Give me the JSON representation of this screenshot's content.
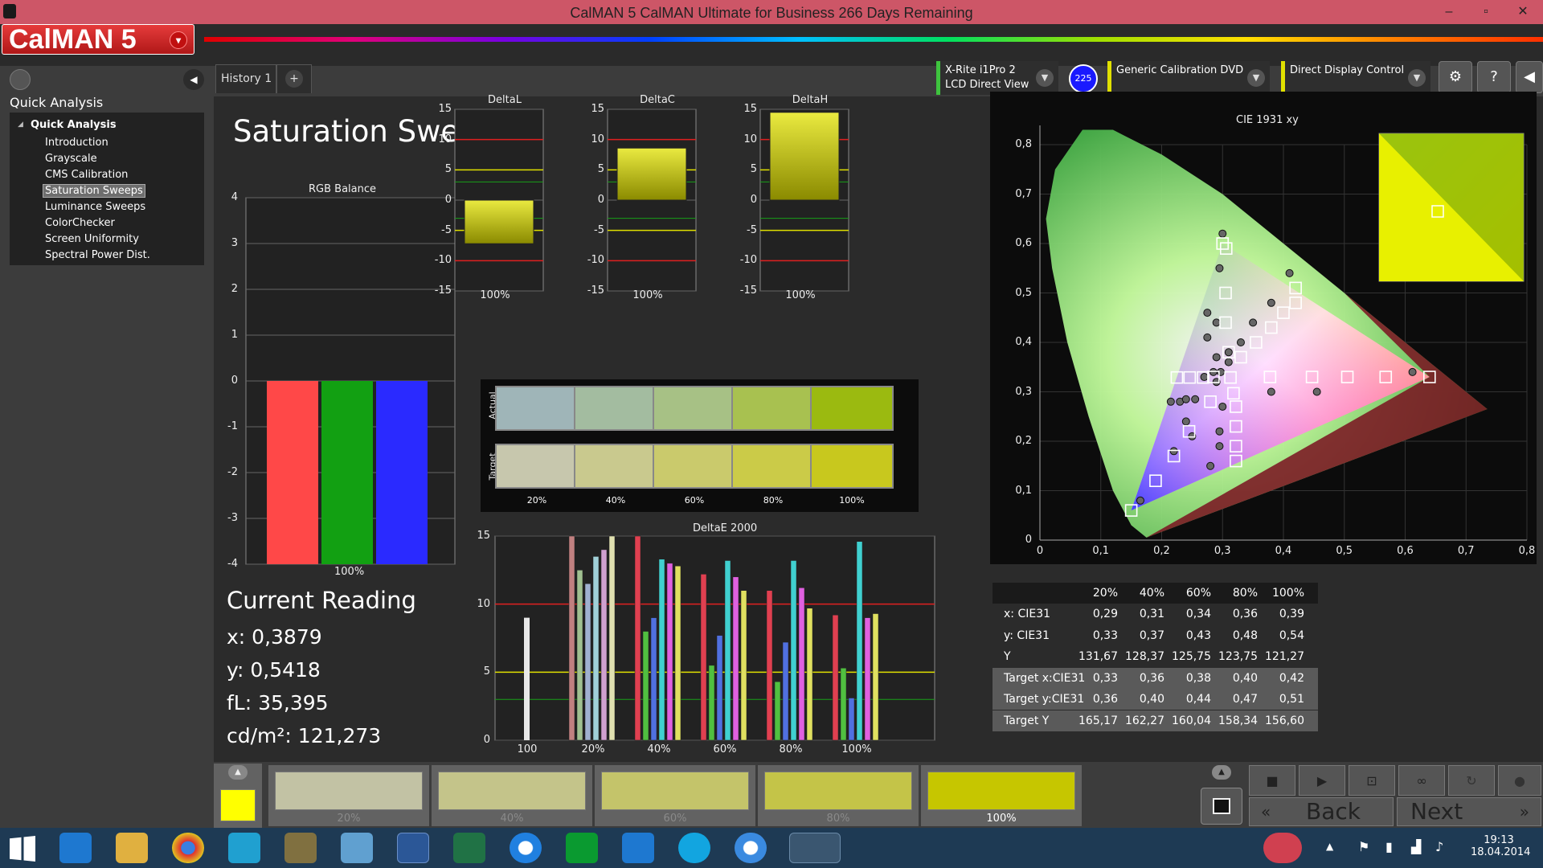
{
  "window": {
    "title": "CalMAN 5 CalMAN Ultimate for Business 266 Days Remaining",
    "minimize": "–",
    "restore": "▫",
    "close": "✕"
  },
  "logo": {
    "text": "CalMAN 5",
    "dropdown": "▾"
  },
  "sidebar": {
    "title": "Quick Analysis",
    "group": "Quick Analysis",
    "items": [
      "Introduction",
      "Grayscale",
      "CMS Calibration",
      "Saturation Sweeps",
      "Luminance Sweeps",
      "ColorChecker",
      "Screen Uniformity",
      "Spectral Power Dist."
    ],
    "selected": "Saturation Sweeps"
  },
  "tabs": {
    "history": "History 1",
    "add": "+"
  },
  "devices": {
    "meter_line1": "X-Rite i1Pro 2",
    "meter_line2": "LCD Direct View",
    "badge": "225",
    "source": "Generic Calibration DVD",
    "display": "Direct Display Control"
  },
  "page": {
    "title": "Saturation Sweeps"
  },
  "rgb_balance": {
    "title": "RGB Balance",
    "label": "100%",
    "yticks": [
      "4",
      "3",
      "2",
      "1",
      "0",
      "-1",
      "-2",
      "-3",
      "-4"
    ]
  },
  "delta_charts": [
    {
      "title": "DeltaL",
      "label": "100%",
      "yticks": [
        "15",
        "10",
        "5",
        "0",
        "-5",
        "-10",
        "-15"
      ]
    },
    {
      "title": "DeltaC",
      "label": "100%",
      "yticks": [
        "15",
        "10",
        "5",
        "0",
        "-5",
        "-10",
        "-15"
      ]
    },
    {
      "title": "DeltaH",
      "label": "100%",
      "yticks": [
        "15",
        "10",
        "5",
        "0",
        "-5",
        "-10",
        "-15"
      ]
    }
  ],
  "swatch_panel": {
    "actual_label": "Actual",
    "target_label": "Target",
    "labels": [
      "20%",
      "40%",
      "60%",
      "80%",
      "100%"
    ],
    "actual_colors": [
      "#9fb5b8",
      "#a3bca0",
      "#a7c185",
      "#a8c150",
      "#9bba10"
    ],
    "target_colors": [
      "#c7c7ad",
      "#c9c98e",
      "#caca6c",
      "#cbcb48",
      "#c8c81e"
    ]
  },
  "deltae": {
    "title": "DeltaE 2000",
    "xticks": [
      "100",
      "20%",
      "40%",
      "60%",
      "80%",
      "100%"
    ],
    "yticks": [
      "15",
      "10",
      "5",
      "0"
    ]
  },
  "current_reading": {
    "title": "Current Reading",
    "x": "x: 0,3879",
    "y": "y: 0,5418",
    "fl": "fL: 35,395",
    "cdm": "cd/m²: 121,273"
  },
  "cie": {
    "title": "CIE 1931 xy",
    "xticks": [
      "0",
      "0,1",
      "0,2",
      "0,3",
      "0,4",
      "0,5",
      "0,6",
      "0,7",
      "0,8"
    ],
    "yticks": [
      "0,8",
      "0,7",
      "0,6",
      "0,5",
      "0,4",
      "0,3",
      "0,2",
      "0,1",
      "0"
    ]
  },
  "table": {
    "headers": [
      "20%",
      "40%",
      "60%",
      "80%",
      "100%"
    ],
    "rows": [
      {
        "label": "x: CIE31",
        "values": [
          "0,29",
          "0,31",
          "0,34",
          "0,36",
          "0,39"
        ]
      },
      {
        "label": "y: CIE31",
        "values": [
          "0,33",
          "0,37",
          "0,43",
          "0,48",
          "0,54"
        ]
      },
      {
        "label": "Y",
        "values": [
          "131,67",
          "128,37",
          "125,75",
          "123,75",
          "121,27"
        ]
      },
      {
        "label": "Target x:CIE31",
        "values": [
          "0,33",
          "0,36",
          "0,38",
          "0,40",
          "0,42"
        ]
      },
      {
        "label": "Target y:CIE31",
        "values": [
          "0,36",
          "0,40",
          "0,44",
          "0,47",
          "0,51"
        ]
      },
      {
        "label": "Target Y",
        "values": [
          "165,17",
          "162,27",
          "160,04",
          "158,34",
          "156,60"
        ]
      }
    ]
  },
  "bottom": {
    "swatches": [
      {
        "label": "20%",
        "color": "#c2c2a4"
      },
      {
        "label": "40%",
        "color": "#c4c48a"
      },
      {
        "label": "60%",
        "color": "#c4c46a"
      },
      {
        "label": "80%",
        "color": "#c4c448"
      },
      {
        "label": "100%",
        "color": "#c6c600"
      }
    ],
    "current_color": "#ffff00",
    "back": "Back",
    "next": "Next"
  },
  "chart_data": [
    {
      "type": "bar",
      "title": "RGB Balance",
      "categories": [
        "100%"
      ],
      "series": [
        {
          "values": [
            -4
          ]
        },
        {
          "values": [
            -4
          ]
        },
        {
          "values": [
            -4
          ]
        }
      ],
      "ylim": [
        -4,
        4
      ]
    },
    {
      "type": "bar",
      "title": "DeltaL",
      "categories": [
        "100%"
      ],
      "values": [
        -7.2
      ],
      "ylim": [
        -15,
        15
      ]
    },
    {
      "type": "bar",
      "title": "DeltaC",
      "categories": [
        "100%"
      ],
      "values": [
        8.6
      ],
      "ylim": [
        -15,
        15
      ]
    },
    {
      "type": "bar",
      "title": "DeltaH",
      "categories": [
        "100%"
      ],
      "values": [
        14.5
      ],
      "ylim": [
        -15,
        15
      ]
    },
    {
      "type": "bar",
      "title": "DeltaE 2000",
      "categories": [
        "100",
        "20%",
        "40%",
        "60%",
        "80%",
        "100%"
      ],
      "ylim": [
        0,
        15
      ],
      "groups": [
        [
          9
        ],
        [
          15,
          12.5,
          11.5,
          13.5,
          14,
          15
        ],
        [
          15,
          8,
          9,
          13.3,
          13,
          12.8
        ],
        [
          12.2,
          5.5,
          7.7,
          13.2,
          12,
          11
        ],
        [
          11,
          4.3,
          7.2,
          13.2,
          11.2,
          9.7
        ],
        [
          9.2,
          5.3,
          3.1,
          14.6,
          9,
          9.3
        ]
      ]
    },
    {
      "type": "scatter",
      "title": "CIE 1931 xy",
      "xlim": [
        0,
        0.8
      ],
      "ylim": [
        0,
        0.8
      ],
      "targets": [
        [
          0.64,
          0.33
        ],
        [
          0.3,
          0.6
        ],
        [
          0.15,
          0.06
        ],
        [
          0.225,
          0.329
        ],
        [
          0.246,
          0.329
        ],
        [
          0.268,
          0.329
        ],
        [
          0.285,
          0.33
        ],
        [
          0.313,
          0.329
        ],
        [
          0.378,
          0.33
        ],
        [
          0.447,
          0.33
        ],
        [
          0.505,
          0.33
        ],
        [
          0.568,
          0.33
        ],
        [
          0.306,
          0.59
        ],
        [
          0.305,
          0.5
        ],
        [
          0.305,
          0.44
        ],
        [
          0.31,
          0.38
        ],
        [
          0.42,
          0.48
        ],
        [
          0.4,
          0.46
        ],
        [
          0.38,
          0.43
        ],
        [
          0.355,
          0.4
        ],
        [
          0.33,
          0.37
        ],
        [
          0.318,
          0.297
        ],
        [
          0.322,
          0.27
        ],
        [
          0.322,
          0.23
        ],
        [
          0.322,
          0.19
        ],
        [
          0.322,
          0.16
        ],
        [
          0.19,
          0.12
        ],
        [
          0.22,
          0.17
        ],
        [
          0.245,
          0.22
        ],
        [
          0.28,
          0.28
        ],
        [
          0.42,
          0.51
        ]
      ],
      "actuals": [
        [
          0.612,
          0.34
        ],
        [
          0.3,
          0.62
        ],
        [
          0.165,
          0.08
        ],
        [
          0.215,
          0.28
        ],
        [
          0.23,
          0.28
        ],
        [
          0.24,
          0.285
        ],
        [
          0.255,
          0.285
        ],
        [
          0.29,
          0.32
        ],
        [
          0.38,
          0.3
        ],
        [
          0.455,
          0.3
        ],
        [
          0.275,
          0.46
        ],
        [
          0.29,
          0.44
        ],
        [
          0.275,
          0.41
        ],
        [
          0.29,
          0.37
        ],
        [
          0.31,
          0.36
        ],
        [
          0.41,
          0.54
        ],
        [
          0.38,
          0.48
        ],
        [
          0.35,
          0.44
        ],
        [
          0.33,
          0.4
        ],
        [
          0.31,
          0.38
        ],
        [
          0.295,
          0.55
        ],
        [
          0.3,
          0.27
        ],
        [
          0.295,
          0.22
        ],
        [
          0.295,
          0.19
        ],
        [
          0.28,
          0.15
        ],
        [
          0.25,
          0.21
        ],
        [
          0.22,
          0.18
        ],
        [
          0.24,
          0.24
        ],
        [
          0.27,
          0.33
        ],
        [
          0.285,
          0.34
        ],
        [
          0.297,
          0.34
        ]
      ]
    }
  ]
}
